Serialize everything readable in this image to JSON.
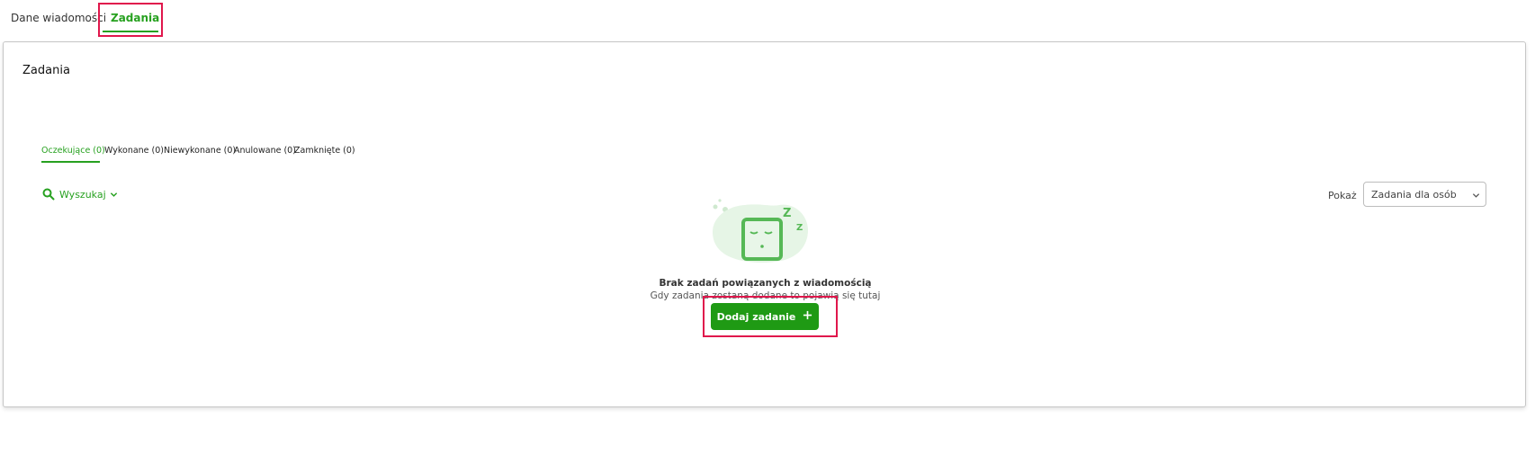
{
  "top_tabs": [
    {
      "label": "Dane wiadomości",
      "active": false
    },
    {
      "label": "Zadania",
      "active": true
    }
  ],
  "card": {
    "title": "Zadania"
  },
  "status_tabs": [
    {
      "label": "Oczekujące (0)",
      "active": true
    },
    {
      "label": "Wykonane (0)",
      "active": false
    },
    {
      "label": "Niewykonane (0)",
      "active": false
    },
    {
      "label": "Anulowane (0)",
      "active": false
    },
    {
      "label": "Zamknięte (0)",
      "active": false
    }
  ],
  "search": {
    "label": "Wyszukaj",
    "icon": "search-icon"
  },
  "filter": {
    "label": "Pokaż",
    "selected": "Zadania dla osób"
  },
  "empty_state": {
    "title": "Brak zadań powiązanych z wiadomością",
    "subtitle": "Gdy zadania zostaną dodane to pojawią się tutaj",
    "button_label": "Dodaj zadanie"
  },
  "colors": {
    "accent": "#27a120",
    "button": "#1f9a14",
    "highlight": "#e0174c"
  }
}
